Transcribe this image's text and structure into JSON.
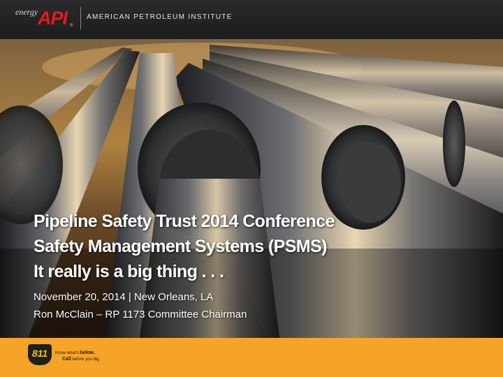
{
  "header": {
    "logo_energy": "energy",
    "logo_api": "API",
    "logo_reg": "®",
    "org_name": "AMERICAN PETROLEUM INSTITUTE"
  },
  "slide": {
    "title_lines": [
      "Pipeline Safety Trust  2014 Conference",
      "Safety Management Systems (PSMS)",
      "It really is a big thing . . ."
    ],
    "subtitle_1": "November 20, 2014  |  New Orleans, LA",
    "subtitle_2": "Ron McClain – RP 1173 Committee Chairman"
  },
  "footer": {
    "badge_number": "811",
    "tagline_1_prefix": "Know what's ",
    "tagline_1_bold": "below.",
    "tagline_2_bold": "Call",
    "tagline_2_suffix": " before you dig."
  },
  "colors": {
    "header_bg": "#222222",
    "api_red": "#e11b22",
    "footer_orange": "#f5a427",
    "title_text": "#ffffff"
  }
}
